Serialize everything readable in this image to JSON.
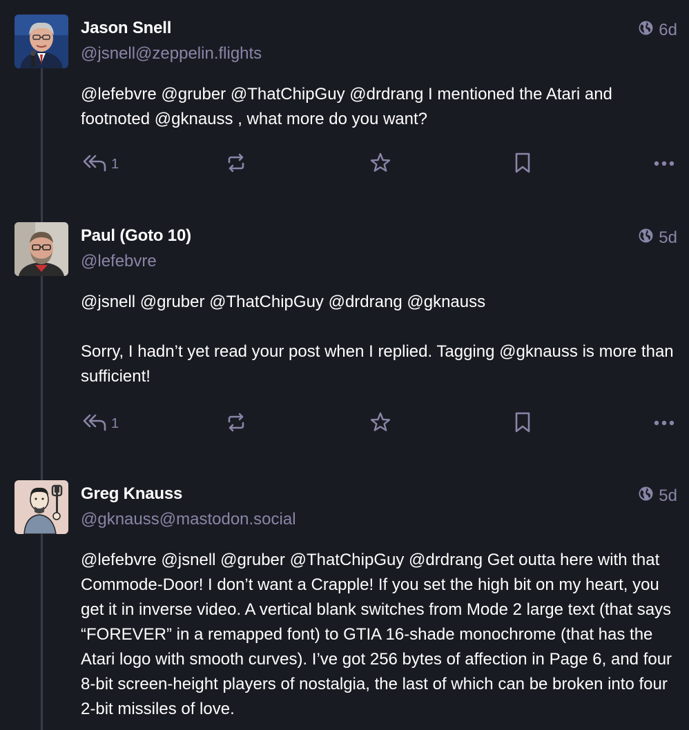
{
  "posts": [
    {
      "display_name": "Jason Snell",
      "handle": "@jsnell@zeppelin.flights",
      "visibility_icon": "globe-icon",
      "time": "6d",
      "paragraphs": [
        [
          {
            "text": "@lefebvre",
            "mention": true
          },
          {
            "text": " "
          },
          {
            "text": "@gruber",
            "mention": true
          },
          {
            "text": " "
          },
          {
            "text": "@ThatChipGuy",
            "mention": true
          },
          {
            "text": " "
          },
          {
            "text": "@drdrang",
            "mention": true
          },
          {
            "text": " I mentioned the Atari and footnoted "
          },
          {
            "text": "@gknauss",
            "mention": true
          },
          {
            "text": " , what more do you want?"
          }
        ]
      ],
      "reply_count": "1"
    },
    {
      "display_name": "Paul (Goto 10)",
      "handle": "@lefebvre",
      "visibility_icon": "globe-icon",
      "time": "5d",
      "paragraphs": [
        [
          {
            "text": "@jsnell",
            "mention": true
          },
          {
            "text": " "
          },
          {
            "text": "@gruber",
            "mention": true
          },
          {
            "text": " "
          },
          {
            "text": "@ThatChipGuy",
            "mention": true
          },
          {
            "text": " "
          },
          {
            "text": "@drdrang",
            "mention": true
          },
          {
            "text": " "
          },
          {
            "text": "@gknauss",
            "mention": true
          }
        ],
        [
          {
            "text": "Sorry, I hadn’t yet read your post when I replied. Tagging "
          },
          {
            "text": "@gknauss",
            "mention": true
          },
          {
            "text": " is more than sufficient!"
          }
        ]
      ],
      "reply_count": "1"
    },
    {
      "display_name": "Greg Knauss",
      "handle": "@gknauss@mastodon.social",
      "visibility_icon": "globe-icon",
      "time": "5d",
      "paragraphs": [
        [
          {
            "text": "@lefebvre",
            "mention": true
          },
          {
            "text": " "
          },
          {
            "text": "@jsnell",
            "mention": true
          },
          {
            "text": " "
          },
          {
            "text": "@gruber",
            "mention": true
          },
          {
            "text": " "
          },
          {
            "text": "@ThatChipGuy",
            "mention": true
          },
          {
            "text": " "
          },
          {
            "text": "@drdrang",
            "mention": true
          },
          {
            "text": " Get outta here with that Commode-Door! I don’t want a Crapple! If you set the high bit on my heart, you get it in inverse video. A vertical blank switches from Mode 2 large text (that says “FOREVER” in a remapped font) to GTIA 16-shade monochrome (that has the Atari logo with smooth curves). I’ve got 256 bytes of affection in Page 6, and four 8-bit screen-height players of nostalgia, the last of which can be broken into four 2-bit missiles of love."
          }
        ]
      ],
      "reply_count": ""
    }
  ],
  "action_icons": {
    "reply": "reply-all-icon",
    "boost": "boost-icon",
    "favourite": "star-icon",
    "bookmark": "bookmark-icon",
    "more": "ellipsis-icon"
  },
  "colors": {
    "background": "#191b22",
    "muted": "#8886a8",
    "text": "#ffffff",
    "thread_line": "#3a3b48"
  }
}
